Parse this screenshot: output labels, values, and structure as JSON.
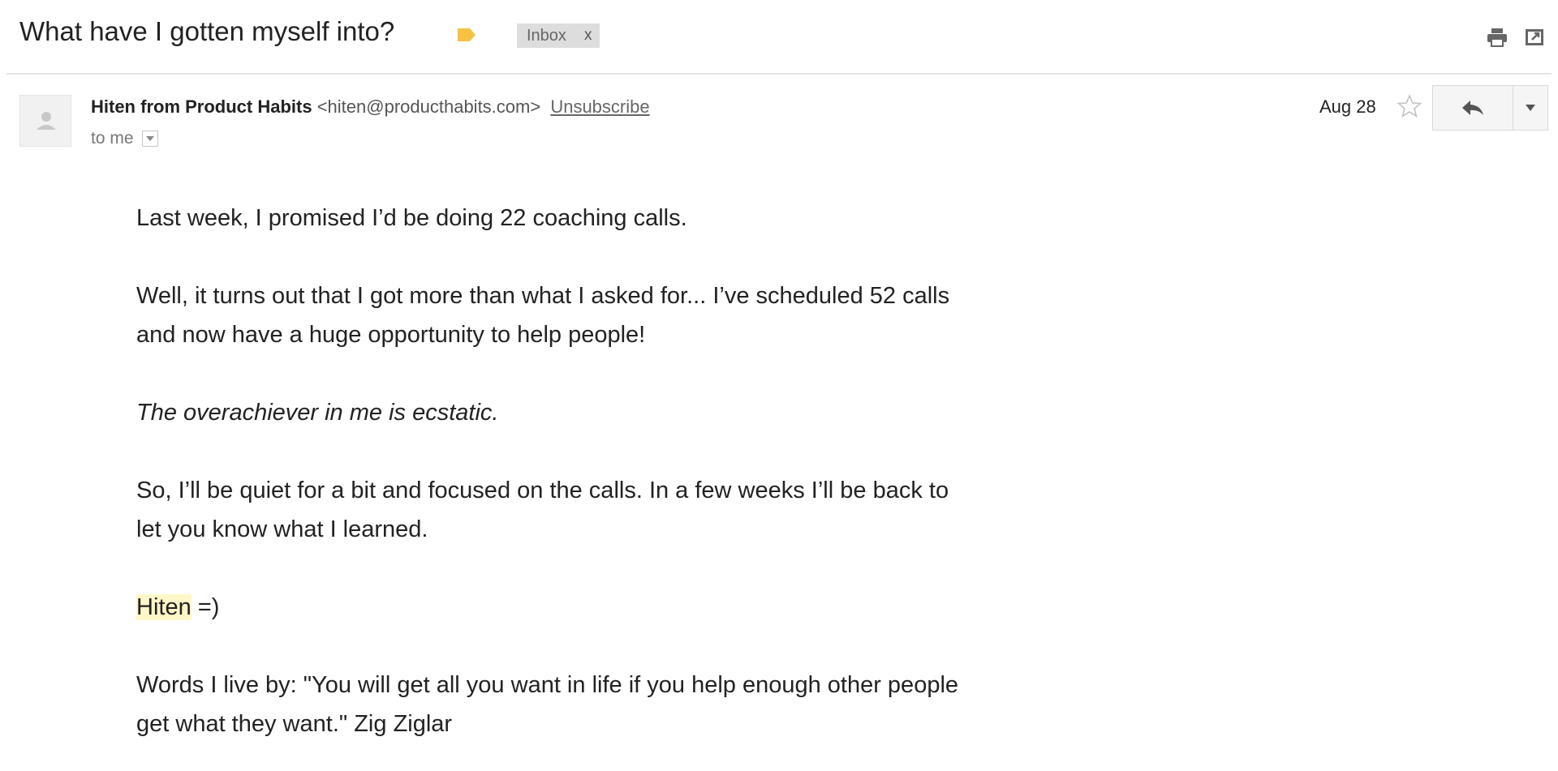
{
  "header": {
    "subject": "What have I gotten myself into?",
    "label_chip": "Inbox",
    "label_chip_close": "x",
    "tag_color": "#f5c242"
  },
  "icons": {
    "label": "label-tag-icon",
    "print": "print-icon",
    "new_window": "open-in-new-window-icon",
    "avatar": "person-icon",
    "star": "star-outline-icon",
    "reply": "reply-arrow-icon",
    "more": "chevron-down-icon",
    "to_details": "caret-down-icon"
  },
  "message": {
    "sender_name": "Hiten from Product Habits",
    "sender_email": "<hiten@producthabits.com>",
    "unsubscribe": "Unsubscribe",
    "to": "to me",
    "date": "Aug 28"
  },
  "body": {
    "p1": "Last week, I promised I’d be doing 22 coaching calls.",
    "p2_line1": "Well, it turns out that I got more than what I asked for... I’ve scheduled 52 calls",
    "p2_line2": "and now have a huge opportunity to help people!",
    "p3": "The overachiever in me is ecstatic.",
    "p4_line1": "So, I’ll be quiet for a bit and focused on the calls. In a few weeks I’ll be back to",
    "p4_line2": "let you know what I learned.",
    "sig_name": "Hiten",
    "sig_smiley": " =)",
    "quote_line1": "Words I live by: \"You will get all you want in life if you help enough other people",
    "quote_line2": "get what they want.\" Zig Ziglar"
  },
  "colors": {
    "highlight": "#fff7c8",
    "chip_bg": "#dddddd"
  }
}
